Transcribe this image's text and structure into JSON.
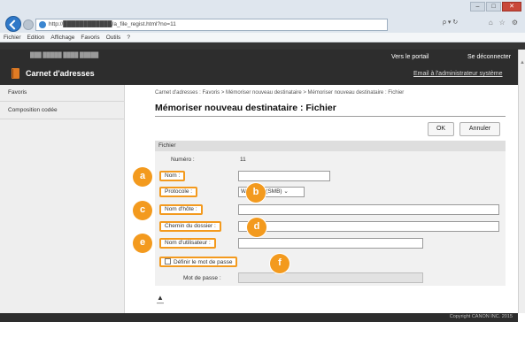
{
  "browser": {
    "url": "http://████████████/a_file_regist.html?no=11",
    "search_glyph": "ρ ▾ ↻",
    "menu": [
      "Fichier",
      "Edition",
      "Affichage",
      "Favoris",
      "Outils",
      "?"
    ],
    "window_buttons": [
      "–",
      "□",
      "✕"
    ]
  },
  "header": {
    "title": "Carnet d'adresses",
    "portal_link": "Vers le portail",
    "logout_link": "Se déconnecter",
    "admin_mail_link": "Email à l'administrateur système",
    "user_line": "███ █████ ████ █████"
  },
  "sidebar": {
    "items": [
      {
        "label": "Favoris"
      },
      {
        "label": "Composition codée"
      }
    ]
  },
  "main": {
    "breadcrumb": "Carnet d'adresses : Favoris > Mémoriser nouveau destinataire > Mémoriser nouveau destinataire : Fichier",
    "title": "Mémoriser nouveau destinataire : Fichier",
    "ok_label": "OK",
    "cancel_label": "Annuler"
  },
  "form": {
    "section_label": "Fichier",
    "number_label": "Numéro :",
    "number_value": "11",
    "name_label": "Nom :",
    "protocol_label": "Protocole :",
    "protocol_value": "Windows (SMB)",
    "host_label": "Nom d'hôte :",
    "folder_label": "Chemin du dossier :",
    "username_label": "Nom d'utilisateur :",
    "set_password_label": "Définir le mot de passe",
    "password_label": "Mot de passe :"
  },
  "badges": [
    "a",
    "b",
    "c",
    "d",
    "e",
    "f"
  ],
  "footer": {
    "copyright": "Copyright CANON INC. 2015"
  },
  "icons": {
    "back": "back-arrow-icon",
    "forward": "forward-arrow-icon",
    "address_book": "address-book-icon",
    "back_to_top": "back-to-top-icon"
  },
  "colors": {
    "accent": "#f39a1e",
    "header_bg": "#2d2d2d"
  }
}
